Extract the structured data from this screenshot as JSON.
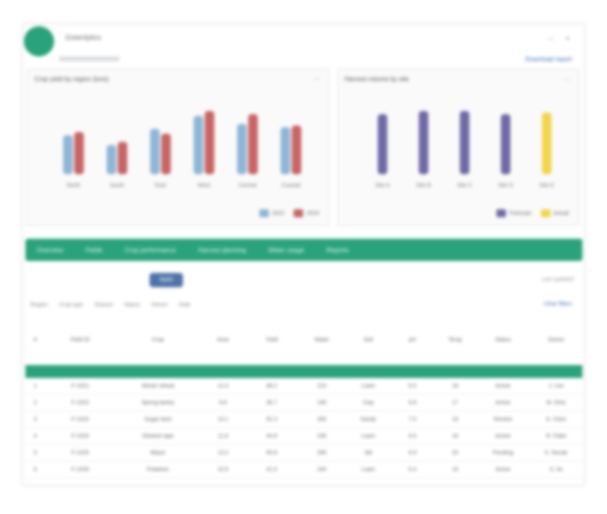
{
  "app": {
    "title": "Greenlytics",
    "window_controls": "— ✕",
    "top_link": "Download report"
  },
  "left_chart_panel": {
    "title": "Crop yield by region (tons)",
    "control": "⋯",
    "legend": [
      {
        "label": "2022",
        "color": "#8fb6d6"
      },
      {
        "label": "2023",
        "color": "#c86464"
      }
    ]
  },
  "right_chart_panel": {
    "title": "Harvest volume by site",
    "control": "⋯",
    "legend": [
      {
        "label": "Forecast",
        "color": "#6f6aa6"
      },
      {
        "label": "Actual",
        "color": "#f1d54c"
      }
    ]
  },
  "chart_data": [
    {
      "type": "bar",
      "title": "Crop yield by region (tons)",
      "categories": [
        "North",
        "South",
        "East",
        "West",
        "Central",
        "Coastal"
      ],
      "series": [
        {
          "name": "2022",
          "values": [
            48,
            36,
            56,
            72,
            62,
            58
          ]
        },
        {
          "name": "2023",
          "values": [
            52,
            40,
            50,
            78,
            74,
            60
          ]
        }
      ],
      "ylim": [
        0,
        100
      ],
      "grid": false,
      "legend": "bottom-right"
    },
    {
      "type": "bar",
      "title": "Harvest volume by site",
      "categories": [
        "Site A",
        "Site B",
        "Site C",
        "Site D",
        "Site E"
      ],
      "series": [
        {
          "name": "Forecast",
          "values": [
            74,
            78,
            78,
            74,
            0
          ]
        },
        {
          "name": "Actual",
          "values": [
            0,
            0,
            0,
            0,
            76
          ]
        }
      ],
      "ylim": [
        0,
        100
      ],
      "grid": false,
      "legend": "bottom-right"
    }
  ],
  "nav_tabs": [
    "Overview",
    "Fields",
    "Crop performance",
    "Harvest planning",
    "Water usage",
    "Reports"
  ],
  "toolbar": {
    "active_pill": "Apply",
    "right_text": "Last updated"
  },
  "filters": [
    "Region",
    "Crop type",
    "Season",
    "Status",
    "Owner",
    "Date"
  ],
  "filter_link": "Clear filters",
  "table": {
    "columns": [
      "#",
      "Field ID",
      "Crop",
      "Area",
      "Yield",
      "Water",
      "Soil",
      "pH",
      "Temp",
      "Status",
      "Owner"
    ],
    "rows": [
      [
        "1",
        "F-1021",
        "Winter wheat",
        "12.4",
        "48.2",
        "210",
        "Loam",
        "6.5",
        "18",
        "Active",
        "J. Lee"
      ],
      [
        "2",
        "F-1022",
        "Spring barley",
        "9.8",
        "36.7",
        "190",
        "Clay",
        "6.8",
        "17",
        "Active",
        "M. Ortiz"
      ],
      [
        "3",
        "F-1023",
        "Sugar beet",
        "14.1",
        "52.3",
        "260",
        "Sandy",
        "7.0",
        "19",
        "Review",
        "A. Chen"
      ],
      [
        "4",
        "F-1024",
        "Oilseed rape",
        "11.6",
        "44.9",
        "230",
        "Loam",
        "6.6",
        "18",
        "Active",
        "R. Patel"
      ],
      [
        "5",
        "F-1025",
        "Maize",
        "13.2",
        "50.8",
        "280",
        "Silt",
        "6.9",
        "20",
        "Pending",
        "K. Novak"
      ],
      [
        "6",
        "F-1026",
        "Potatoes",
        "10.5",
        "41.0",
        "240",
        "Loam",
        "6.4",
        "16",
        "Active",
        "S. Ito"
      ]
    ]
  }
}
